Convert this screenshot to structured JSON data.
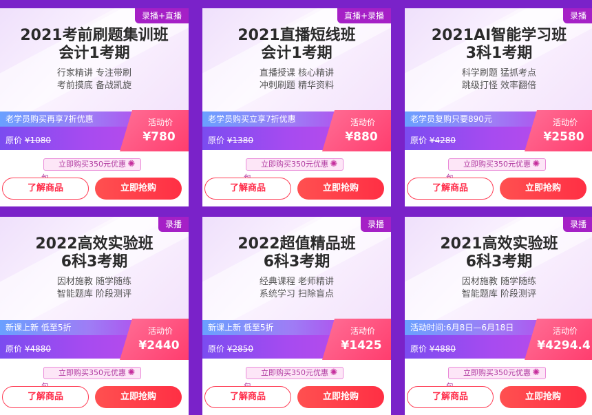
{
  "common": {
    "activity_label": "活动价",
    "orig_prefix": "原价",
    "coupon": "立即购买350元优惠",
    "coupon_tail": "包",
    "info_button": "了解商品",
    "buy_button": "立即抢购",
    "colors": {
      "page_bg": "#7a22c9",
      "tag_bg": "#a520c6",
      "accent": "#ff3d55"
    }
  },
  "cards": [
    {
      "tag": "录播+直播",
      "title1": "2021考前刷题集训班",
      "title2": "会计1考期",
      "desc1": "行家精讲 专注带刷",
      "desc2": "考前摸底 备战凯旋",
      "promo": "老学员购买再享7折优惠",
      "orig": "¥1080",
      "price": "¥780"
    },
    {
      "tag": "直播+录播",
      "title1": "2021直播短线班",
      "title2": "会计1考期",
      "desc1": "直播授课 核心精讲",
      "desc2": "冲刺刷题 精华资料",
      "promo": "老学员购买立享7折优惠",
      "orig": "¥1380",
      "price": "¥880"
    },
    {
      "tag": "录播",
      "title1": "2021AI智能学习班",
      "title2": "3科1考期",
      "desc1": "科学刷题 猛抓考点",
      "desc2": "跳级打怪 效率翻倍",
      "promo": "老学员复购只要890元",
      "orig": "¥4280",
      "price": "¥2580"
    },
    {
      "tag": "录播",
      "title1": "2022高效实验班",
      "title2": "6科3考期",
      "desc1": "因材施教 随学随练",
      "desc2": "智能题库 阶段测评",
      "promo": "新课上新 低至5折",
      "orig": "¥4880",
      "price": "¥2440"
    },
    {
      "tag": "录播",
      "title1": "2022超值精品班",
      "title2": "6科3考期",
      "desc1": "经典课程 老师精讲",
      "desc2": "系统学习 扫除盲点",
      "promo": "新课上新 低至5折",
      "orig": "¥2850",
      "price": "¥1425"
    },
    {
      "tag": "录播",
      "title1": "2021高效实验班",
      "title2": "6科3考期",
      "desc1": "因材施教 随学随练",
      "desc2": "智能题库 阶段测评",
      "promo": "活动时间:6月8日—6月18日",
      "orig": "¥4880",
      "price": "¥4294.4"
    }
  ]
}
